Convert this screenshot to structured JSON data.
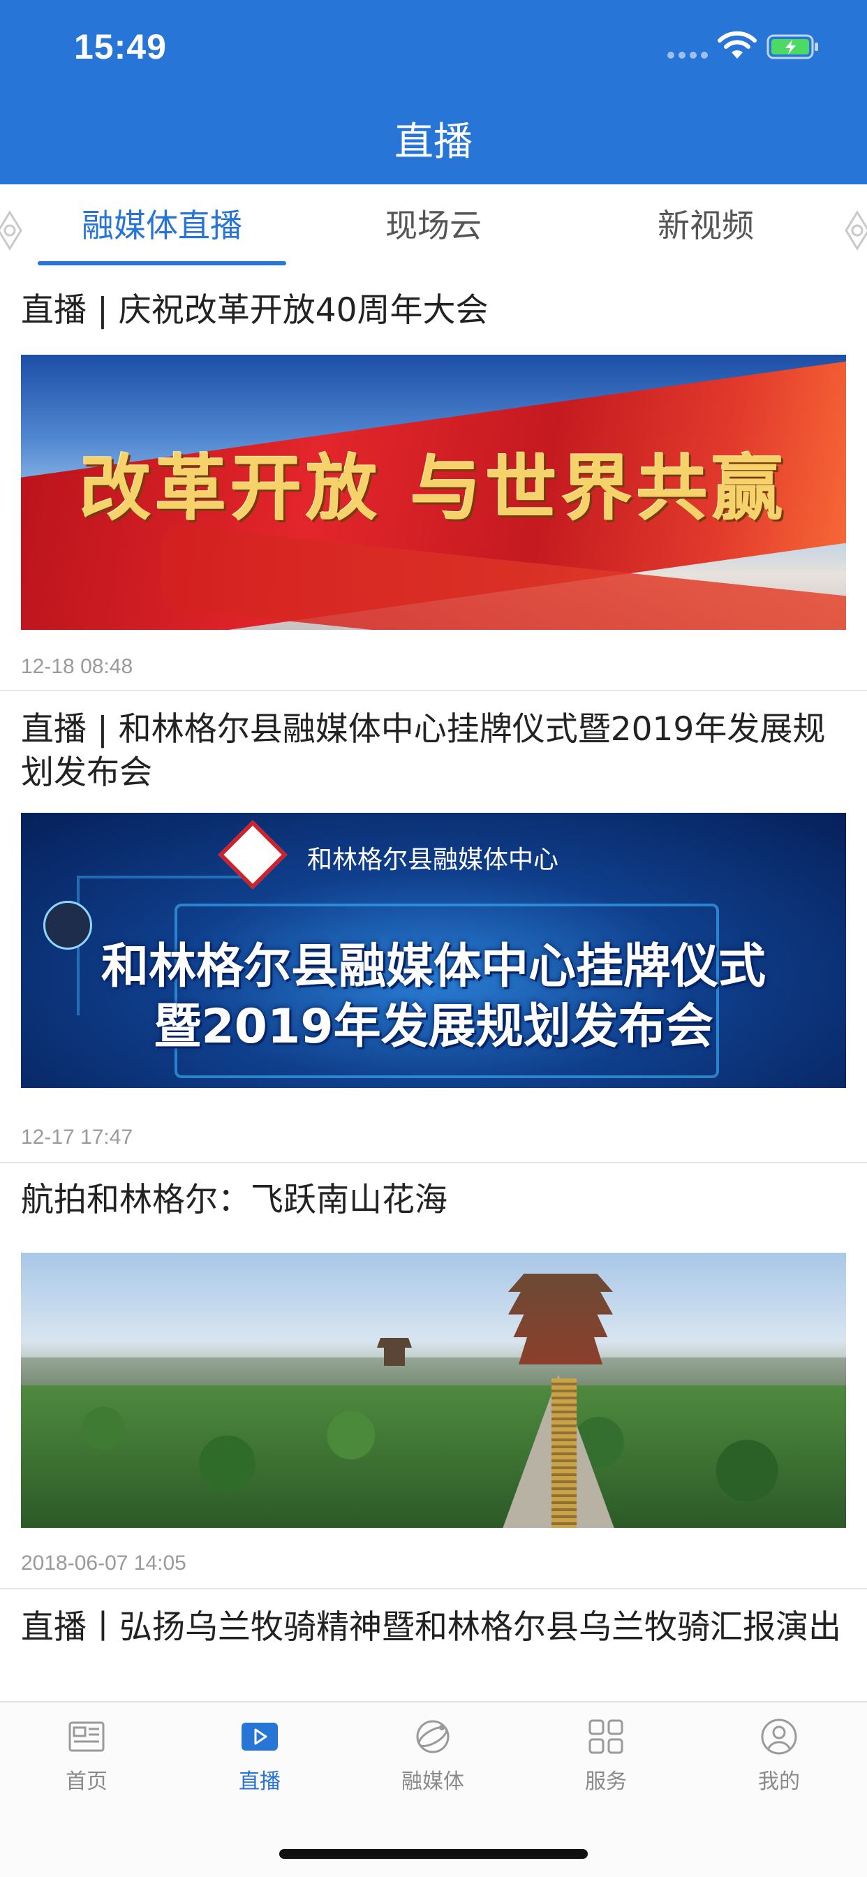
{
  "status_bar": {
    "time": "15:49"
  },
  "header": {
    "title": "直播"
  },
  "tabs": [
    {
      "label": "融媒体直播",
      "active": true
    },
    {
      "label": "现场云",
      "active": false
    },
    {
      "label": "新视频",
      "active": false
    }
  ],
  "feed": [
    {
      "title": "直播 | 庆祝改革开放40周年大会",
      "thumb_text": "改革开放 与世界共赢",
      "time": "12-18 08:48"
    },
    {
      "title": "直播 | 和林格尔县融媒体中心挂牌仪式暨2019年发展规划发布会",
      "thumb_org": "和林格尔县融媒体中心",
      "thumb_line1": "和林格尔县融媒体中心挂牌仪式",
      "thumb_line2": "暨2019年发展规划发布会",
      "time": "12-17 17:47"
    },
    {
      "title": "航拍和林格尔：飞跃南山花海",
      "time": "2018-06-07 14:05"
    },
    {
      "title": "直播丨弘扬乌兰牧骑精神暨和林格尔县乌兰牧骑汇报演出"
    }
  ],
  "tabbar": [
    {
      "label": "首页",
      "icon": "news-icon",
      "active": false
    },
    {
      "label": "直播",
      "icon": "play-icon",
      "active": true
    },
    {
      "label": "融媒体",
      "icon": "globe-icon",
      "active": false
    },
    {
      "label": "服务",
      "icon": "grid-icon",
      "active": false
    },
    {
      "label": "我的",
      "icon": "profile-icon",
      "active": false
    }
  ],
  "colors": {
    "brand": "#2775d6",
    "muted": "#9a9a9a"
  }
}
